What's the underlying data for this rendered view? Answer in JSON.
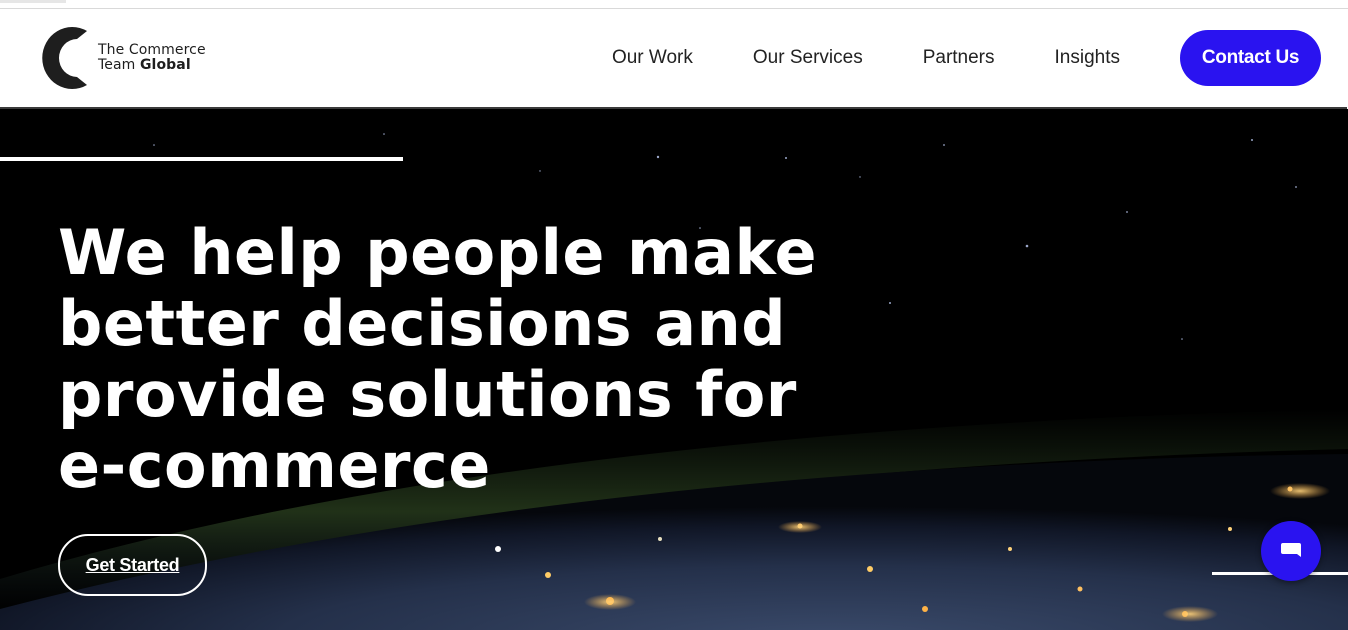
{
  "brand": {
    "line1": "The Commerce",
    "line2_regular": "Team",
    "line2_bold": "Global"
  },
  "nav": {
    "items": [
      {
        "label": "Our Work"
      },
      {
        "label": "Our Services"
      },
      {
        "label": "Partners"
      },
      {
        "label": "Insights"
      }
    ],
    "cta_label": "Contact Us"
  },
  "hero": {
    "headline_lines": [
      "We help people make",
      "better decisions and",
      "provide solutions for",
      "e-commerce"
    ],
    "button_label": "Get Started",
    "background": "night-earth-from-space"
  },
  "chat": {
    "icon": "chat-bubble-icon"
  },
  "colors": {
    "accent": "#2a13f0",
    "hero_bg": "#000000",
    "text_dark": "#222222"
  }
}
